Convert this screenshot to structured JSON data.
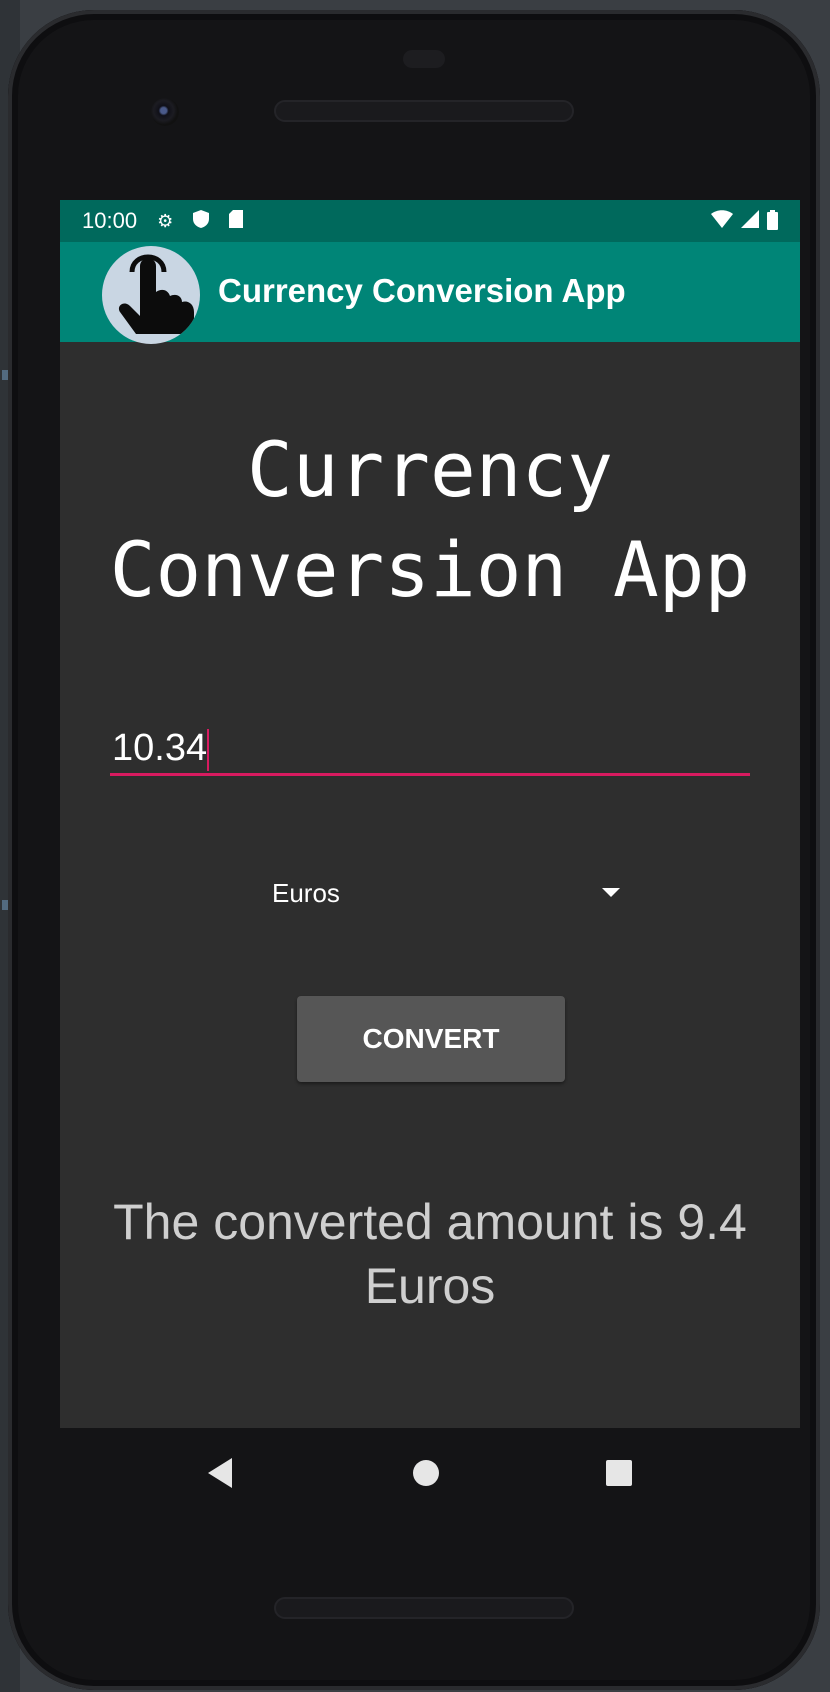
{
  "status_bar": {
    "time": "10:00",
    "icons": [
      "settings-icon",
      "shield-icon",
      "sd-card-icon"
    ],
    "right_icons": [
      "wifi-icon",
      "signal-icon",
      "battery-icon"
    ]
  },
  "app_bar": {
    "title": "Currency Conversion App",
    "logo": "pointing-hand-icon"
  },
  "main": {
    "heading": "Currency Conversion App",
    "amount_value": "10.34",
    "currency_selected": "Euros",
    "convert_label": "CONVERT",
    "result_text": "The converted amount is 9.4 Euros"
  },
  "nav_bar": {
    "buttons": [
      "back-icon",
      "home-icon",
      "recents-icon"
    ]
  },
  "colors": {
    "status_bar": "#00695c",
    "app_bar": "#008577",
    "accent": "#d81b60",
    "background": "#2e2e2e",
    "button": "#565656"
  }
}
